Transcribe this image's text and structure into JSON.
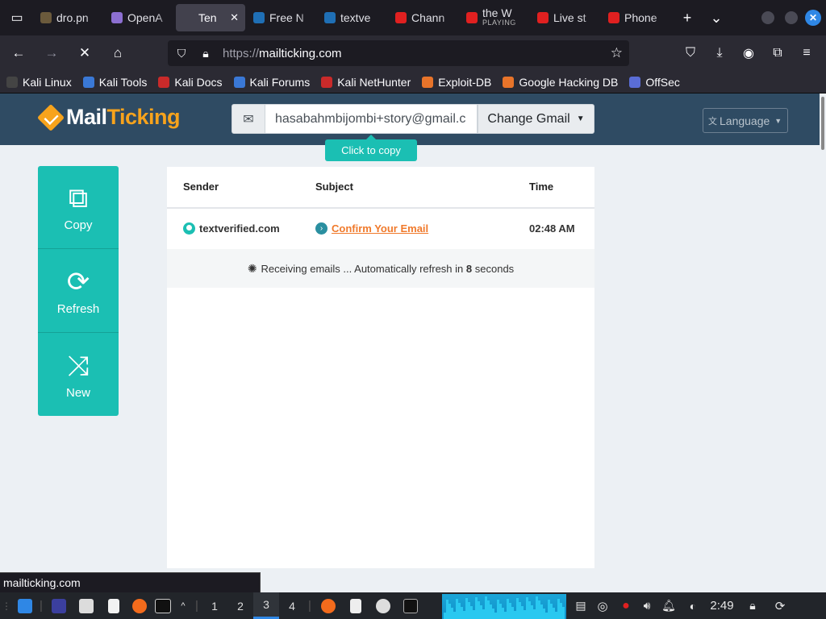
{
  "browser": {
    "tabs": [
      {
        "label": "dro.pn",
        "color": "#6b5a3c"
      },
      {
        "label": "OpenA",
        "color": "#8c6fd1"
      },
      {
        "label": "Ten",
        "color": "#42414d",
        "active": true,
        "close": "✕"
      },
      {
        "label": "Free N",
        "color": "#1f6fb5"
      },
      {
        "label": "textve",
        "color": "#1f6fb5"
      },
      {
        "label": "Chann",
        "color": "#e02020"
      },
      {
        "label": "the W",
        "sub": "PLAYING",
        "color": "#e02020"
      },
      {
        "label": "Live st",
        "color": "#e02020"
      },
      {
        "label": "Phone",
        "color": "#e02020"
      }
    ],
    "new_tab": "+",
    "tab_list": "⌄",
    "url_proto": "https://",
    "url_host": "mailticking.com",
    "bookmarks": [
      {
        "label": "Kali Linux",
        "color": "#444"
      },
      {
        "label": "Kali Tools",
        "color": "#3a78d6"
      },
      {
        "label": "Kali Docs",
        "color": "#c92a2a"
      },
      {
        "label": "Kali Forums",
        "color": "#3a78d6"
      },
      {
        "label": "Kali NetHunter",
        "color": "#c92a2a"
      },
      {
        "label": "Exploit-DB",
        "color": "#e8742a"
      },
      {
        "label": "Google Hacking DB",
        "color": "#e8742a"
      },
      {
        "label": "OffSec",
        "color": "#5a6dd6"
      }
    ],
    "status_url": "mailticking.com"
  },
  "site": {
    "logo_part1": "Mail",
    "logo_part2": "Ticking",
    "email": "hasabahmbijombi+story@gmail.c",
    "change_label": "Change Gmail",
    "language_label": "Language",
    "copy_tip": "Click to copy",
    "actions": {
      "copy": "Copy",
      "refresh": "Refresh",
      "new": "New"
    },
    "table": {
      "headers": {
        "sender": "Sender",
        "subject": "Subject",
        "time": "Time"
      },
      "rows": [
        {
          "sender": "textverified.com",
          "subject": "Confirm Your Email",
          "time": "02:48 AM"
        }
      ]
    },
    "receiving_prefix": "Receiving emails ... Automatically refresh in",
    "refresh_seconds": "8",
    "receiving_suffix": "seconds"
  },
  "taskbar": {
    "workspaces": [
      "1",
      "2",
      "3",
      "4"
    ],
    "current_workspace": "3",
    "clock": "2:49"
  }
}
